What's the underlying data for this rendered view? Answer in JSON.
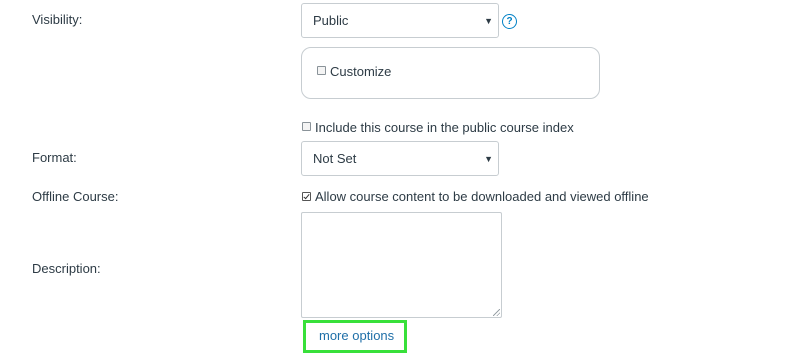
{
  "visibility": {
    "label": "Visibility:",
    "selected": "Public",
    "help_icon": "question-circle-icon",
    "customize_label": "Customize",
    "customize_checked": false
  },
  "public_index": {
    "label": "Include this course in the public course index",
    "checked": false
  },
  "format": {
    "label": "Format:",
    "selected": "Not Set"
  },
  "offline": {
    "label": "Offline Course:",
    "checkbox_label": "Allow course content to be downloaded and viewed offline",
    "checked": true
  },
  "description": {
    "label": "Description:",
    "value": ""
  },
  "more_options": {
    "label": "more options",
    "highlight_color": "#38e03a"
  },
  "colors": {
    "text": "#2d3b45",
    "link": "#1f6fa8",
    "help": "#0081c6",
    "border": "#c7cdd1"
  }
}
